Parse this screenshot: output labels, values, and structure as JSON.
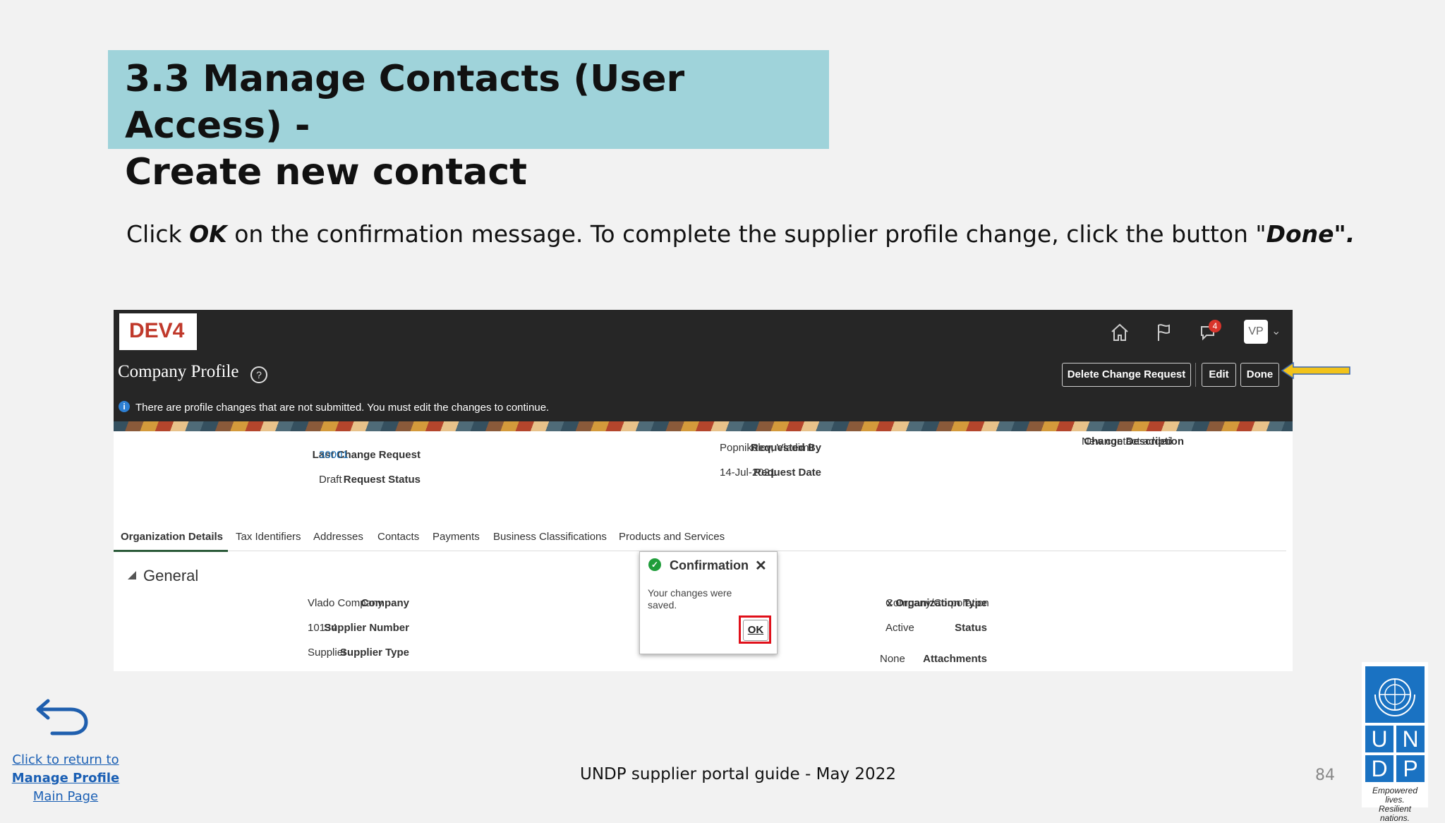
{
  "slide": {
    "title": "3.3 Manage Contacts (User Access) -\nCreate new contact",
    "instruction": {
      "part1": "Click ",
      "ok": "OK",
      "part2": " on the confirmation message. To complete the supplier profile change, click the button \"",
      "done": "Done\"."
    },
    "footer": "UNDP supplier portal guide - May 2022",
    "page_number": "84",
    "return_link": {
      "line1": "Click to return to",
      "line2": "Manage Profile",
      "line3": "Main Page"
    },
    "undp_logo": {
      "letters": [
        "U",
        "N",
        "D",
        "P"
      ],
      "tagline1": "Empowered lives.",
      "tagline2": "Resilient nations."
    }
  },
  "app": {
    "env_label": "DEV4",
    "notification_count": "4",
    "avatar": "VP",
    "page_title": "Company Profile",
    "buttons": {
      "delete": "Delete Change Request",
      "edit": "Edit",
      "done": "Done"
    },
    "info_message": "There are profile changes that are not submitted. You must edit the changes to continue.",
    "summary": {
      "last_change_request_label": "Last Change Request",
      "last_change_request_value": "30001",
      "request_status_label": "Request Status",
      "request_status_value": "Draft",
      "requested_by_label": "Requested By",
      "requested_by_value": "Popnikolov, Vladimir",
      "request_date_label": "Request Date",
      "request_date_value": "14-Jul-2021",
      "change_description_label": "Change Description",
      "change_description_value": "New contact added"
    },
    "tabs": [
      "Organization Details",
      "Tax Identifiers",
      "Addresses",
      "Contacts",
      "Payments",
      "Business Classifications",
      "Products and Services"
    ],
    "section_title": "General",
    "general": {
      "company_label": "Company",
      "company_value": "Vlado Company",
      "supplier_number_label": "Supplier Number",
      "supplier_number_value": "10134",
      "supplier_type_label": "Supplier Type",
      "supplier_type_value": "Supplier",
      "org_type_label": "x Organization Type",
      "org_type_value": "Company/Corporation",
      "status_label": "Status",
      "status_value": "Active",
      "attachments_label": "Attachments",
      "attachments_value": "None"
    },
    "dialog": {
      "title": "Confirmation",
      "message": "Your changes were saved.",
      "ok": "OK"
    }
  },
  "colors": {
    "title_bg": "#9fd3da",
    "highlight": "#e0101a",
    "arrow": "#f2c31b",
    "undp_blue": "#1a72c2"
  }
}
